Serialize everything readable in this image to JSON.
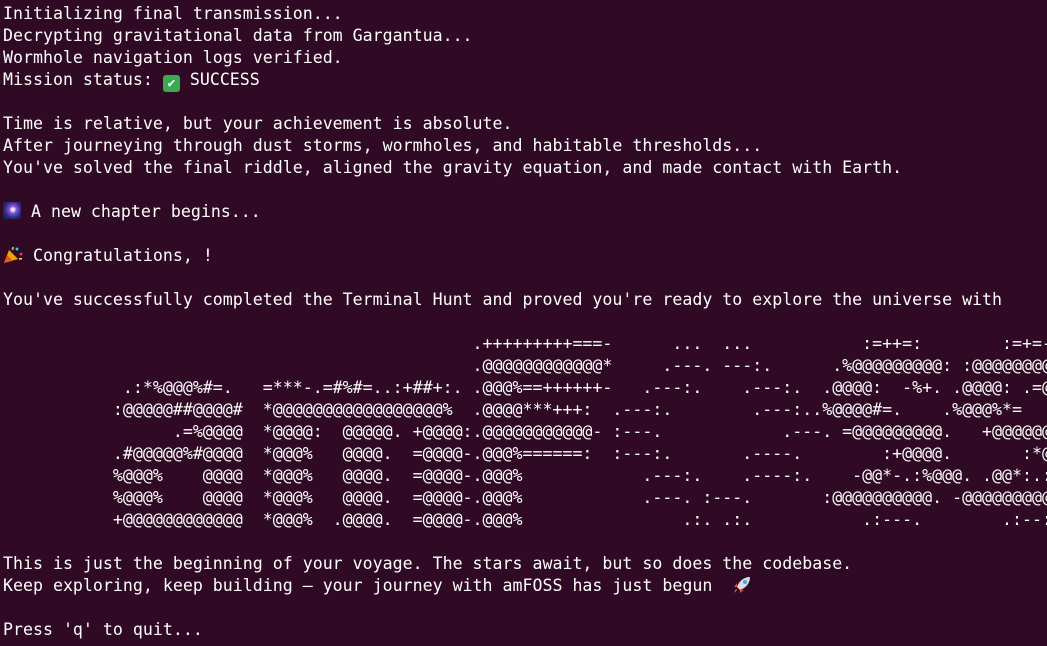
{
  "terminal": {
    "lines": {
      "init": "Initializing final transmission...",
      "decrypt": "Decrypting gravitational data from Gargantua...",
      "logs": "Wormhole navigation logs verified.",
      "status_label": "Mission status: ",
      "status_value": " SUCCESS",
      "relative": "Time is relative, but your achievement is absolute.",
      "journey": "After journeying through dust storms, wormholes, and habitable thresholds...",
      "solved": "You've solved the final riddle, aligned the gravity equation, and made contact with Earth.",
      "chapter": " A new chapter begins...",
      "congrats": " Congratulations, !",
      "completed": "You've successfully completed the Terminal Hunt and proved you're ready to explore the universe with",
      "beginning": "This is just the beginning of your voyage. The stars await, but so does the codebase.",
      "exploring": "Keep exploring, keep building — your journey with amFOSS has just begun  ",
      "quit": "Press 'q' to quit..."
    },
    "ascii_art": "                                               .+++++++++===-      ...  ...           :=++=:        :=+=-\n                                               .@@@@@@@@@@@@*     .---. ---:.      .%@@@@@@@@@: :@@@@@@@@@@\n            .:*%@@@%#=.   =***-.=#%#=..:+##+:. .@@@%==++++++-   .---:.    .---:.  .@@@@:  -%+. .@@@@: .=@=\n           :@@@@@##@@@@#  *@@@@@@@@@@@@@@@@@%  .@@@@***+++:  .---:.        .---:..%@@@@#=.    .%@@@%*=\n                 .=%@@@@  *@@@@:  @@@@@. +@@@@:.@@@@@@@@@@@- :---.            .---. =@@@@@@@@@.   +@@@@@@@%\n           .#@@@@@%#@@@@  *@@@%   @@@@.  =@@@@-.@@@%======:  :---:.       .----.        :+@@@@.       :*@@@\n           %@@@%    @@@@  *@@@%   @@@@.  =@@@@-.@@@%            .---:.    .----:.    -@@*-.:%@@@. .@@*:.:@@@\n           %@@@%    @@@@  *@@@%   @@@@.  =@@@@-.@@@%            .---. :---.       :@@@@@@@@@@. -@@@@@@@@@#\n           +@@@@@@@@@@@@  *@@@%  .@@@@.  =@@@@-.@@@%                .:. .:.           .:---.        .:--:."
  }
}
